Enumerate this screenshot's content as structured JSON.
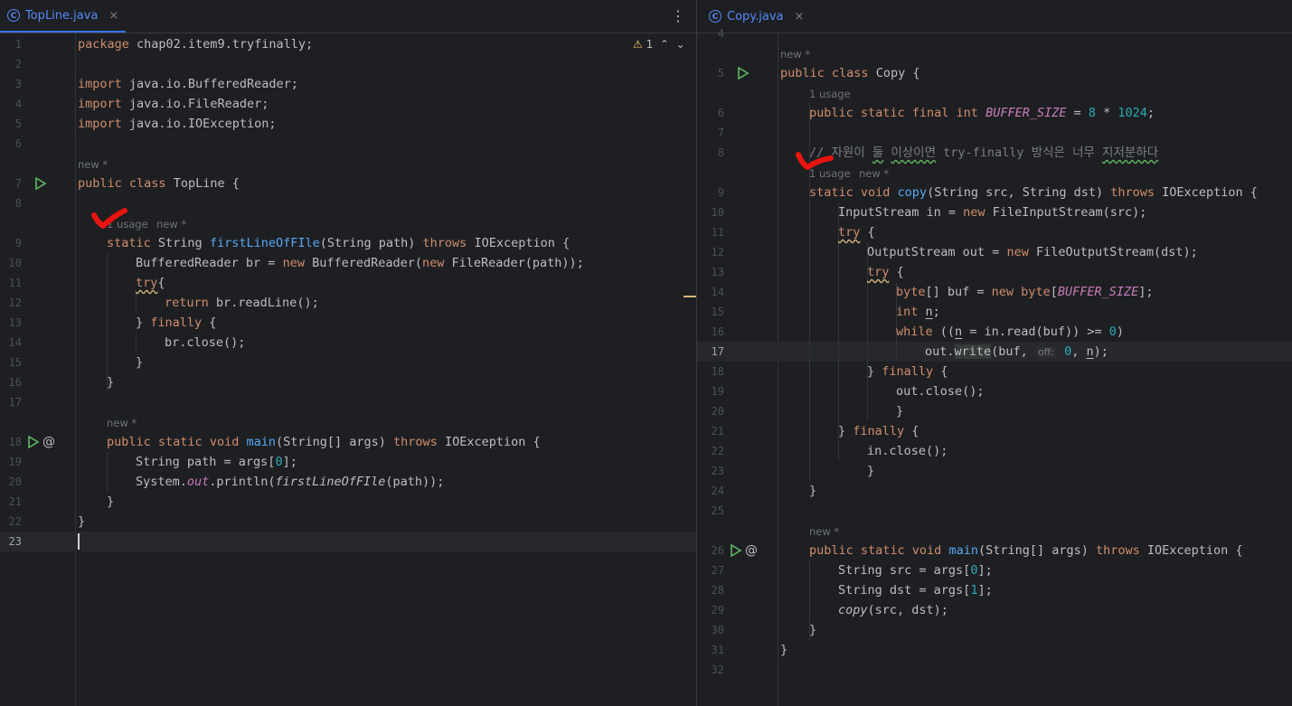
{
  "left": {
    "tab": {
      "icon": "C",
      "name": "TopLine.java",
      "close": "×"
    },
    "menu": "⋮",
    "inspection": {
      "icon": "⚠",
      "count": "1",
      "up": "⌃",
      "down": "⌄"
    },
    "lines": [
      "1",
      "2",
      "3",
      "4",
      "5",
      "6",
      "7",
      "8",
      "9",
      "10",
      "11",
      "12",
      "13",
      "14",
      "15",
      "16",
      "17",
      "18",
      "19",
      "20",
      "21",
      "22",
      "23"
    ],
    "hints": {
      "h7": "new *",
      "h9a": "1 usage",
      "h9b": "new *",
      "h18": "new *"
    },
    "code": {
      "l1a": "package",
      "l1b": " chap02.item9.tryfinally;",
      "imp": "import",
      "l3": " java.io.BufferedReader;",
      "l4": " java.io.FileReader;",
      "l5": " java.io.IOException;",
      "pub": "public",
      "cls": "class",
      "l7": " TopLine {",
      "stat": "static",
      "l9a": " String ",
      "l9fn": "firstLineOfFIle",
      "l9b": "(String path) ",
      "thr": "throws",
      "l9c": " IOException {",
      "l10a": "BufferedReader br = ",
      "newk": "new",
      "l10b": " BufferedReader(",
      "l10c": " FileReader(path));",
      "tryk": "try",
      "l11": "{",
      "ret": "return",
      "l12": " br.readLine();",
      "l13a": "} ",
      "fin": "finally",
      "l13b": " {",
      "l14": "br.close();",
      "cb": "}",
      "l18void": " void ",
      "l18fn": "main",
      "l18b": "(String[] args) ",
      "l18c": " IOException {",
      "l19a": "String path = args[",
      "l19n": "0",
      "l19b": "];",
      "l20a": "System.",
      "l20out": "out",
      "l20b": ".println(",
      "l20fn": "firstLineOfFIle",
      "l20c": "(path));"
    }
  },
  "right": {
    "tab": {
      "icon": "C",
      "name": "Copy.java",
      "close": "×"
    },
    "lines": [
      "4",
      "5",
      "6",
      "7",
      "8",
      "9",
      "10",
      "11",
      "12",
      "13",
      "14",
      "15",
      "16",
      "17",
      "18",
      "19",
      "20",
      "21",
      "22",
      "23",
      "24",
      "25",
      "26",
      "27",
      "28",
      "29",
      "30",
      "31",
      "32"
    ],
    "hints": {
      "h5": "new *",
      "h6": "1 usage",
      "h9a": "1 usage",
      "h9b": "new *",
      "h26": "new *"
    },
    "code": {
      "l5a": "public",
      "l5b": " class",
      "l5c": " Copy {",
      "l6a": "public static final int ",
      "l6c": "BUFFER_SIZE",
      "l6d": " = ",
      "l6e": "8",
      "l6f": " * ",
      "l6g": "1024",
      "l6h": ";",
      "l8a": "// 자원이 ",
      "l8b": "둘",
      "l8c": " ",
      "l8d": "이상이면",
      "l8e": " try-finally 방식은 너무 ",
      "l8f": "지저분하다",
      "l9a": "static void ",
      "l9fn": "copy",
      "l9b": "(String src, String dst) ",
      "l9c": "throws",
      "l9d": " IOException {",
      "l10a": "InputStream in = ",
      "l10b": "new",
      "l10c": " FileInputStream(src);",
      "l11a": "try",
      "l11b": " {",
      "l12a": "OutputStream out = ",
      "l12b": "new",
      "l12c": " FileOutputStream(dst);",
      "l13a": "try",
      "l13b": " {",
      "l14a": "byte",
      "l14b": "[] buf = ",
      "l14c": "new byte",
      "l14d": "[",
      "l14e": "BUFFER_SIZE",
      "l14f": "];",
      "l15a": "int ",
      "l15b": "n",
      "l15c": ";",
      "l16a": "while",
      "l16b": " ((",
      "l16c": "n",
      "l16d": " = in.read(buf)) >= ",
      "l16e": "0",
      "l16f": ")",
      "l17a": "out.",
      "l17b": "write",
      "l17c": "(buf, ",
      "l17inlay": "off:",
      "l17d": " ",
      "l17e": "0",
      "l17f": ", ",
      "l17g": "n",
      "l17h": ");",
      "l18a": "} ",
      "l18b": "finally",
      "l18c": " {",
      "l19": "out.close();",
      "cb": "}",
      "l21a": "} ",
      "l21b": "finally",
      "l21c": " {",
      "l22": "in.close();",
      "l26a": "public static void ",
      "l26fn": "main",
      "l26b": "(String[] args) ",
      "l26c": "throws",
      "l26d": " IOException {",
      "l27a": "String src = args[",
      "l27n": "0",
      "l27b": "];",
      "l28a": "String dst = args[",
      "l28n": "1",
      "l28b": "];",
      "l29fn": "copy",
      "l29b": "(src, dst);"
    }
  }
}
